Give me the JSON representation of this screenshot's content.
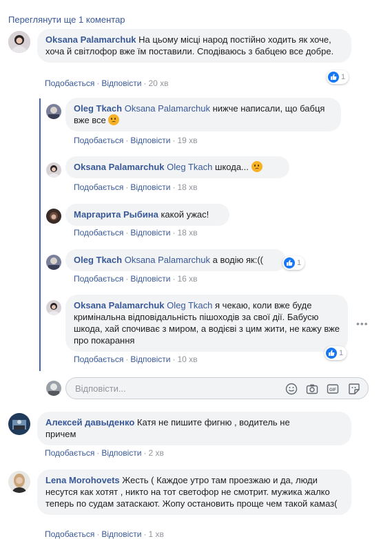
{
  "view_more": "Переглянути ще 1 коментар",
  "labels": {
    "like": "Подобається",
    "reply": "Відповісти",
    "sep": "·"
  },
  "reply_placeholder": "Відповісти...",
  "comments": [
    {
      "author": "Oksana Palamarchuk",
      "text": "На цьому місці народ постійно ходить як хоче, хоча й світлофор вже їм поставили. Сподіваюсь з бабцею все добре.",
      "time": "20 хв",
      "reactions": "1"
    }
  ],
  "replies": [
    {
      "author": "Oleg Tkach",
      "mention": "Oksana Palamarchuk",
      "text": "нижче написали, що бабця вже все",
      "time": "19 хв"
    },
    {
      "author": "Oksana Palamarchuk",
      "mention": "Oleg Tkach",
      "text": "шкода...",
      "time": "18 хв"
    },
    {
      "author": "Маргарита Рыбина",
      "text": "какой ужас!",
      "time": "18 хв"
    },
    {
      "author": "Oleg Tkach",
      "mention": "Oksana Palamarchuk",
      "text": "а водію як:((",
      "time": "16 хв",
      "reactions": "1"
    },
    {
      "author": "Oksana Palamarchuk",
      "mention": "Oleg Tkach",
      "text": "я чекаю, коли вже буде кримінальна відповідальність пішоходів за свої дії. Бабусю шкода, хай спочиває з миром, а водієві з цим жити, не кажу вже про покарання",
      "time": "10 хв",
      "reactions": "1"
    }
  ],
  "more_comments": [
    {
      "author": "Алексей давыденко",
      "text": "Катя не пишите фигню , водитель не причем",
      "time": "2 хв"
    },
    {
      "author": "Lena Morohovets",
      "text": "Жесть ( Каждое утро там проезжаю и да, люди несутся как хотят , никто на тот светофор не смотрит. мужика жалко теперь по судам затаскают. Жопу остановить проще чем такой камаз(",
      "time": "1 хв"
    }
  ],
  "colors": {
    "link": "#385898",
    "bubble": "#f2f3f5",
    "muted": "#90949c",
    "thread": "#4267b2",
    "like": "#1877f2"
  }
}
